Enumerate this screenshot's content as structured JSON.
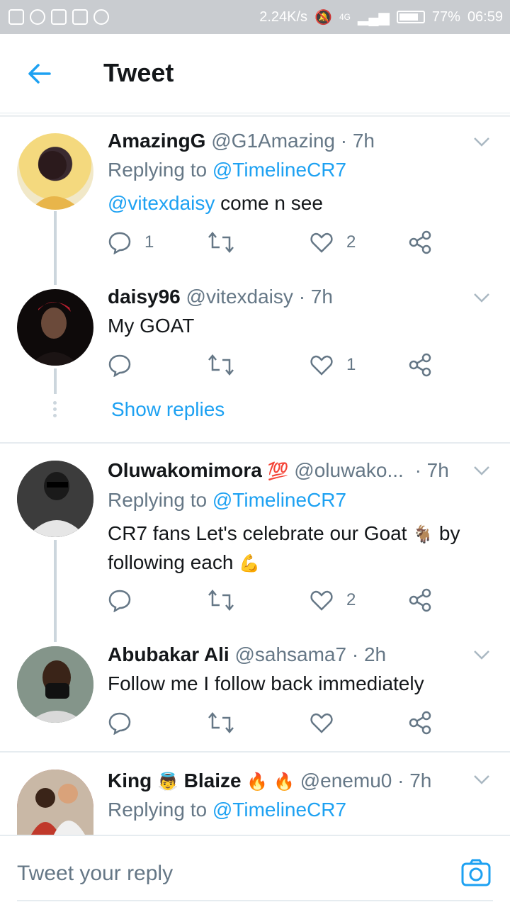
{
  "status_bar": {
    "speed": "2.24K/s",
    "network": "4G",
    "battery": "77%",
    "time": "06:59"
  },
  "header": {
    "title": "Tweet"
  },
  "tweets": [
    {
      "name": "AmazingG",
      "handle": "@G1Amazing",
      "time": "· 7h",
      "replying_prefix": "Replying to",
      "replying_to": "@TimelineCR7",
      "mention": "@vitexdaisy",
      "text": " come n see",
      "replies": "1",
      "retweets": "",
      "likes": "2"
    },
    {
      "name": "daisy96",
      "handle": "@vitexdaisy",
      "time": "· 7h",
      "text": "My GOAT",
      "replies": "",
      "retweets": "",
      "likes": "1"
    },
    {
      "name": "Oluwakomimora",
      "name_emoji": "💯",
      "handle": "@oluwako...",
      "time": "· 7h",
      "replying_prefix": "Replying to",
      "replying_to": "@TimelineCR7",
      "text_1": "CR7 fans Let's celebrate our Goat",
      "text_emoji_1": "🐐",
      "text_2": " by following each",
      "text_emoji_2": "💪",
      "replies": "",
      "retweets": "",
      "likes": "2"
    },
    {
      "name": "Abubakar Ali",
      "handle": "@sahsama7",
      "time": "· 2h",
      "text": "Follow me I follow back immediately",
      "replies": "",
      "retweets": "",
      "likes": ""
    },
    {
      "name_1": "King",
      "name_emoji_1": "👼",
      "name_2": "Blaize",
      "name_emoji_2": "🔥",
      "name_emoji_3": "🔥",
      "handle": "@enemu0",
      "time": "· 7h",
      "replying_prefix": "Replying to",
      "replying_to": "@TimelineCR7"
    }
  ],
  "show_replies": "Show replies",
  "composer": {
    "placeholder": "Tweet your reply"
  },
  "colors": {
    "accent": "#1da1f2",
    "muted": "#657786",
    "text": "#14171a",
    "thread": "#ccd6dd"
  }
}
